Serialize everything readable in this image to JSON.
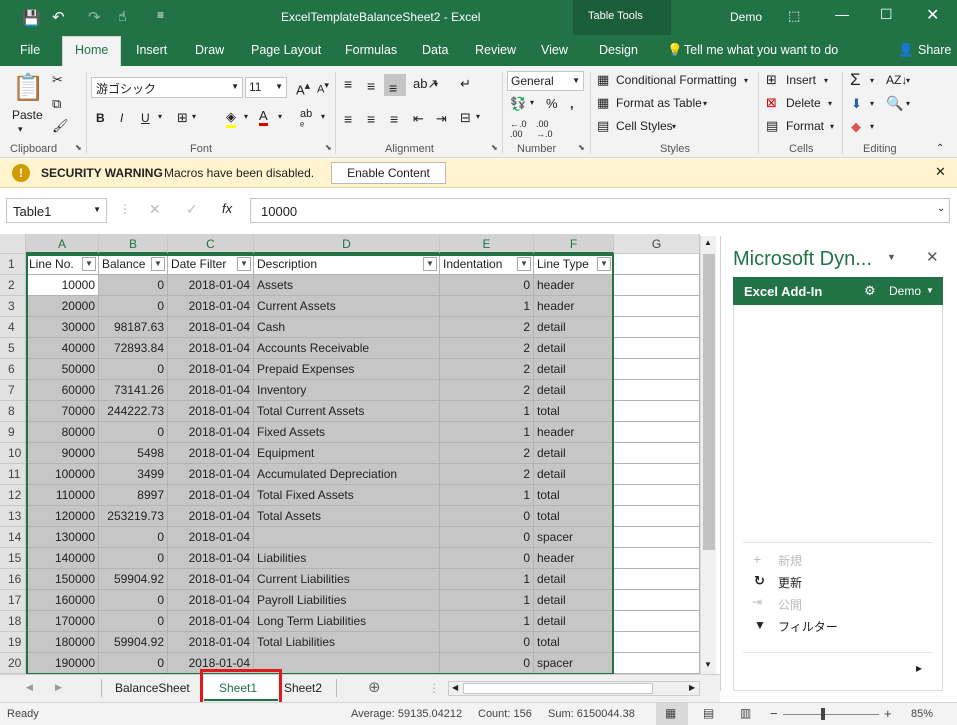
{
  "window": {
    "title": "ExcelTemplateBalanceSheet2 - Excel",
    "context": "Table Tools",
    "user": "Demo"
  },
  "tabs": [
    "File",
    "Home",
    "Insert",
    "Draw",
    "Page Layout",
    "Formulas",
    "Data",
    "Review",
    "View",
    "Design"
  ],
  "tellme": "Tell me what you want to do",
  "share": "Share",
  "ribbon": {
    "clipboard": {
      "paste": "Paste",
      "label": "Clipboard"
    },
    "font": {
      "name": "游ゴシック",
      "size": "11",
      "label": "Font"
    },
    "alignment": {
      "label": "Alignment"
    },
    "number": {
      "format": "General",
      "label": "Number"
    },
    "styles": {
      "cond": "Conditional Formatting",
      "table": "Format as Table",
      "cell": "Cell Styles",
      "label": "Styles"
    },
    "cells": {
      "insert": "Insert",
      "delete": "Delete",
      "format": "Format",
      "label": "Cells"
    },
    "editing": {
      "label": "Editing"
    }
  },
  "security": {
    "title": "SECURITY WARNING",
    "msg": "Macros have been disabled.",
    "button": "Enable Content"
  },
  "formula": {
    "namebox": "Table1",
    "value": "10000"
  },
  "columns": [
    "A",
    "B",
    "C",
    "D",
    "E",
    "F",
    "G"
  ],
  "headers": [
    "Line No.",
    "Balance",
    "Date Filter",
    "Description",
    "Indentation",
    "Line Type"
  ],
  "rows": [
    [
      "10000",
      "0",
      "2018-01-04",
      "Assets",
      "0",
      "header"
    ],
    [
      "20000",
      "0",
      "2018-01-04",
      "Current Assets",
      "1",
      "header"
    ],
    [
      "30000",
      "98187.63",
      "2018-01-04",
      "Cash",
      "2",
      "detail"
    ],
    [
      "40000",
      "72893.84",
      "2018-01-04",
      "Accounts Receivable",
      "2",
      "detail"
    ],
    [
      "50000",
      "0",
      "2018-01-04",
      "Prepaid Expenses",
      "2",
      "detail"
    ],
    [
      "60000",
      "73141.26",
      "2018-01-04",
      "Inventory",
      "2",
      "detail"
    ],
    [
      "70000",
      "244222.73",
      "2018-01-04",
      "Total Current Assets",
      "1",
      "total"
    ],
    [
      "80000",
      "0",
      "2018-01-04",
      "Fixed Assets",
      "1",
      "header"
    ],
    [
      "90000",
      "5498",
      "2018-01-04",
      "Equipment",
      "2",
      "detail"
    ],
    [
      "100000",
      "3499",
      "2018-01-04",
      "Accumulated Depreciation",
      "2",
      "detail"
    ],
    [
      "110000",
      "8997",
      "2018-01-04",
      "Total Fixed Assets",
      "1",
      "total"
    ],
    [
      "120000",
      "253219.73",
      "2018-01-04",
      "Total Assets",
      "0",
      "total"
    ],
    [
      "130000",
      "0",
      "2018-01-04",
      "",
      "0",
      "spacer"
    ],
    [
      "140000",
      "0",
      "2018-01-04",
      "Liabilities",
      "0",
      "header"
    ],
    [
      "150000",
      "59904.92",
      "2018-01-04",
      "Current Liabilities",
      "1",
      "detail"
    ],
    [
      "160000",
      "0",
      "2018-01-04",
      "Payroll Liabilities",
      "1",
      "detail"
    ],
    [
      "170000",
      "0",
      "2018-01-04",
      "Long Term Liabilities",
      "1",
      "detail"
    ],
    [
      "180000",
      "59904.92",
      "2018-01-04",
      "Total Liabilities",
      "0",
      "total"
    ],
    [
      "190000",
      "0",
      "2018-01-04",
      "",
      "0",
      "spacer"
    ]
  ],
  "pane": {
    "title": "Microsoft Dyn...",
    "bar": "Excel Add-In",
    "user": "Demo",
    "actions": [
      "新規",
      "更新",
      "公開",
      "フィルター"
    ]
  },
  "sheets": [
    "BalanceSheet",
    "Sheet1",
    "Sheet2"
  ],
  "status": {
    "ready": "Ready",
    "average": "Average: 59135.04212",
    "count": "Count: 156",
    "sum": "Sum: 6150044.38",
    "zoom": "85%"
  }
}
